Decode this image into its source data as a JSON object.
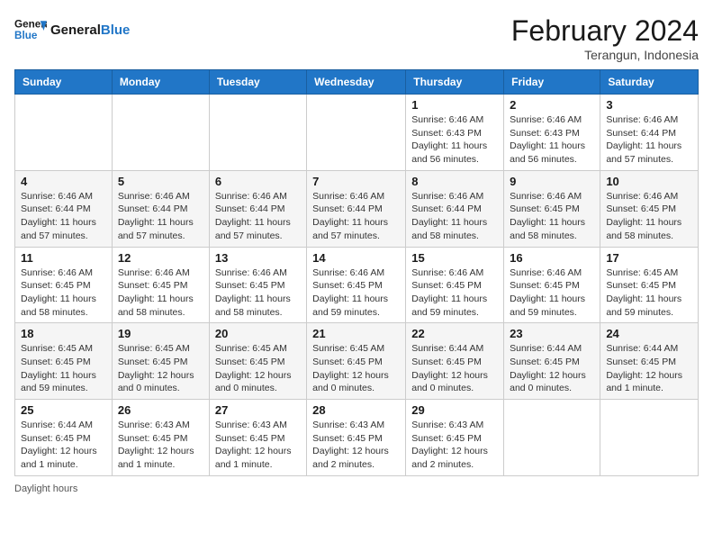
{
  "header": {
    "logo_text_general": "General",
    "logo_text_blue": "Blue",
    "month_year": "February 2024",
    "location": "Terangun, Indonesia"
  },
  "days_of_week": [
    "Sunday",
    "Monday",
    "Tuesday",
    "Wednesday",
    "Thursday",
    "Friday",
    "Saturday"
  ],
  "weeks": [
    [
      {
        "day": "",
        "sunrise": "",
        "sunset": "",
        "daylight": ""
      },
      {
        "day": "",
        "sunrise": "",
        "sunset": "",
        "daylight": ""
      },
      {
        "day": "",
        "sunrise": "",
        "sunset": "",
        "daylight": ""
      },
      {
        "day": "",
        "sunrise": "",
        "sunset": "",
        "daylight": ""
      },
      {
        "day": "1",
        "sunrise": "6:46 AM",
        "sunset": "6:43 PM",
        "daylight": "11 hours and 56 minutes."
      },
      {
        "day": "2",
        "sunrise": "6:46 AM",
        "sunset": "6:43 PM",
        "daylight": "11 hours and 56 minutes."
      },
      {
        "day": "3",
        "sunrise": "6:46 AM",
        "sunset": "6:44 PM",
        "daylight": "11 hours and 57 minutes."
      }
    ],
    [
      {
        "day": "4",
        "sunrise": "6:46 AM",
        "sunset": "6:44 PM",
        "daylight": "11 hours and 57 minutes."
      },
      {
        "day": "5",
        "sunrise": "6:46 AM",
        "sunset": "6:44 PM",
        "daylight": "11 hours and 57 minutes."
      },
      {
        "day": "6",
        "sunrise": "6:46 AM",
        "sunset": "6:44 PM",
        "daylight": "11 hours and 57 minutes."
      },
      {
        "day": "7",
        "sunrise": "6:46 AM",
        "sunset": "6:44 PM",
        "daylight": "11 hours and 57 minutes."
      },
      {
        "day": "8",
        "sunrise": "6:46 AM",
        "sunset": "6:44 PM",
        "daylight": "11 hours and 58 minutes."
      },
      {
        "day": "9",
        "sunrise": "6:46 AM",
        "sunset": "6:45 PM",
        "daylight": "11 hours and 58 minutes."
      },
      {
        "day": "10",
        "sunrise": "6:46 AM",
        "sunset": "6:45 PM",
        "daylight": "11 hours and 58 minutes."
      }
    ],
    [
      {
        "day": "11",
        "sunrise": "6:46 AM",
        "sunset": "6:45 PM",
        "daylight": "11 hours and 58 minutes."
      },
      {
        "day": "12",
        "sunrise": "6:46 AM",
        "sunset": "6:45 PM",
        "daylight": "11 hours and 58 minutes."
      },
      {
        "day": "13",
        "sunrise": "6:46 AM",
        "sunset": "6:45 PM",
        "daylight": "11 hours and 58 minutes."
      },
      {
        "day": "14",
        "sunrise": "6:46 AM",
        "sunset": "6:45 PM",
        "daylight": "11 hours and 59 minutes."
      },
      {
        "day": "15",
        "sunrise": "6:46 AM",
        "sunset": "6:45 PM",
        "daylight": "11 hours and 59 minutes."
      },
      {
        "day": "16",
        "sunrise": "6:46 AM",
        "sunset": "6:45 PM",
        "daylight": "11 hours and 59 minutes."
      },
      {
        "day": "17",
        "sunrise": "6:45 AM",
        "sunset": "6:45 PM",
        "daylight": "11 hours and 59 minutes."
      }
    ],
    [
      {
        "day": "18",
        "sunrise": "6:45 AM",
        "sunset": "6:45 PM",
        "daylight": "11 hours and 59 minutes."
      },
      {
        "day": "19",
        "sunrise": "6:45 AM",
        "sunset": "6:45 PM",
        "daylight": "12 hours and 0 minutes."
      },
      {
        "day": "20",
        "sunrise": "6:45 AM",
        "sunset": "6:45 PM",
        "daylight": "12 hours and 0 minutes."
      },
      {
        "day": "21",
        "sunrise": "6:45 AM",
        "sunset": "6:45 PM",
        "daylight": "12 hours and 0 minutes."
      },
      {
        "day": "22",
        "sunrise": "6:44 AM",
        "sunset": "6:45 PM",
        "daylight": "12 hours and 0 minutes."
      },
      {
        "day": "23",
        "sunrise": "6:44 AM",
        "sunset": "6:45 PM",
        "daylight": "12 hours and 0 minutes."
      },
      {
        "day": "24",
        "sunrise": "6:44 AM",
        "sunset": "6:45 PM",
        "daylight": "12 hours and 1 minute."
      }
    ],
    [
      {
        "day": "25",
        "sunrise": "6:44 AM",
        "sunset": "6:45 PM",
        "daylight": "12 hours and 1 minute."
      },
      {
        "day": "26",
        "sunrise": "6:43 AM",
        "sunset": "6:45 PM",
        "daylight": "12 hours and 1 minute."
      },
      {
        "day": "27",
        "sunrise": "6:43 AM",
        "sunset": "6:45 PM",
        "daylight": "12 hours and 1 minute."
      },
      {
        "day": "28",
        "sunrise": "6:43 AM",
        "sunset": "6:45 PM",
        "daylight": "12 hours and 2 minutes."
      },
      {
        "day": "29",
        "sunrise": "6:43 AM",
        "sunset": "6:45 PM",
        "daylight": "12 hours and 2 minutes."
      },
      {
        "day": "",
        "sunrise": "",
        "sunset": "",
        "daylight": ""
      },
      {
        "day": "",
        "sunrise": "",
        "sunset": "",
        "daylight": ""
      }
    ]
  ],
  "legend": {
    "daylight_label": "Daylight hours"
  }
}
